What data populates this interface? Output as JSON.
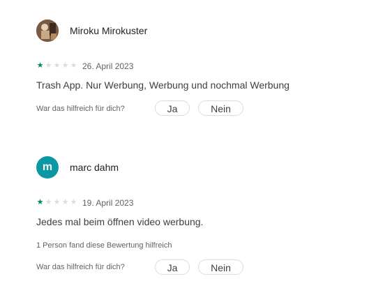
{
  "reviews": [
    {
      "author": "Miroku Mirokuster",
      "avatar_type": "photo",
      "rating": 1,
      "max_rating": 5,
      "date": "26. April 2023",
      "text": "Trash App. Nur Werbung, Werbung und nochmal Werbung",
      "helpful_count_text": "",
      "helpful_question": "War das hilfreich für dich?",
      "yes_label": "Ja",
      "no_label": "Nein"
    },
    {
      "author": "marc dahm",
      "avatar_type": "letter",
      "avatar_letter": "m",
      "avatar_color": "#0b97a3",
      "rating": 1,
      "max_rating": 5,
      "date": "19. April 2023",
      "text": "Jedes mal beim öffnen video werbung.",
      "helpful_count_text": "1 Person fand diese Bewertung hilfreich",
      "helpful_question": "War das hilfreich für dich?",
      "yes_label": "Ja",
      "no_label": "Nein"
    }
  ],
  "colors": {
    "star_on": "#01875f",
    "star_off": "#dadce0"
  },
  "icons": {
    "star": "star-icon"
  }
}
